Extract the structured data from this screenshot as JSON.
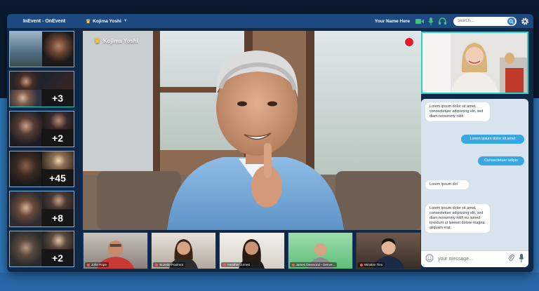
{
  "app_title": "InEvent - OnEvent",
  "room": {
    "name": "Kojima Yoshi"
  },
  "header": {
    "user_name": "Your Name Here",
    "search_placeholder": "search..."
  },
  "sidebar": {
    "tiles": [
      {
        "badge": ""
      },
      {
        "badge": "+3"
      },
      {
        "badge": "+2"
      },
      {
        "badge": "+45"
      },
      {
        "badge": "+8"
      },
      {
        "badge": "+2"
      }
    ]
  },
  "main_video": {
    "speaker": "Kojima Yoshi",
    "recording": true
  },
  "participants": [
    {
      "name": "John Pope"
    },
    {
      "name": "Suzette Poulmot"
    },
    {
      "name": "Heather Jurnett"
    },
    {
      "name": "James Desmond - Denve..."
    },
    {
      "name": "Winston Tieu"
    }
  ],
  "chat": {
    "messages": [
      {
        "direction": "in",
        "text": "Lorem ipsum dolor sit amet, consectetuer adipiscing elit, sed diam nonummy nibh"
      },
      {
        "direction": "out",
        "text": "Lorem ipsum dolor sit amet"
      },
      {
        "direction": "out",
        "text": "Consectetuer adipis"
      },
      {
        "direction": "in",
        "text": "Lorem ipsum dol"
      },
      {
        "direction": "in",
        "text": "Lorem ipsum dolor sit amet, consectetuer adipiscing elit, sed diam nonummy nibh eu iamed tincidunt ut laoreet dolore magna aliquam erat"
      }
    ],
    "input_placeholder": "your message..."
  },
  "colors": {
    "accent": "#2f7fd6",
    "frame": "#0f2848",
    "topbar": "#1d4a80",
    "active": "#2bd1c7",
    "record": "#e8192c",
    "bubble_out": "#39a7e3"
  }
}
